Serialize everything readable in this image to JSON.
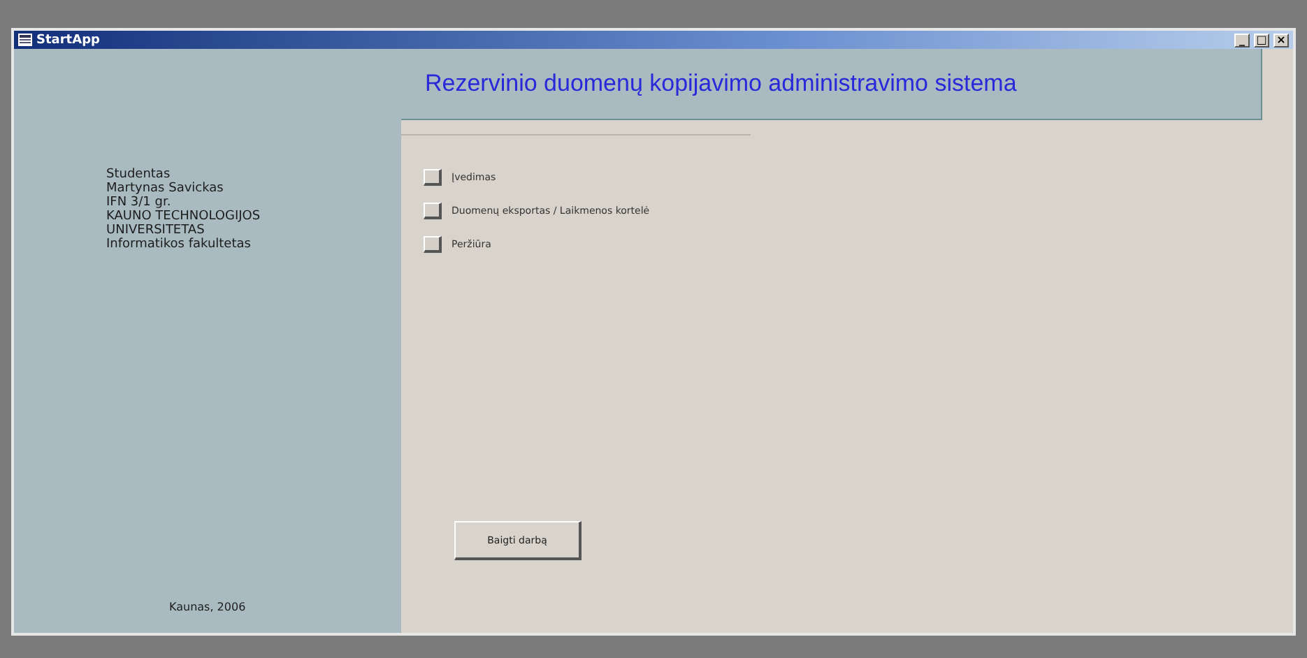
{
  "window": {
    "title": "StartApp",
    "controls": [
      "_",
      "□",
      "×"
    ]
  },
  "sidebar": {
    "lines": [
      "Studentas",
      "Martynas Savickas",
      "IFN 3/1 gr.",
      "KAUNO TECHNOLOGIJOS",
      "UNIVERSITETAS",
      "Informatikos fakultetas"
    ],
    "footer": "Kaunas, 2006"
  },
  "header": {
    "title": "Rezervinio duomenų kopijavimo administravimo sistema"
  },
  "menu": [
    {
      "label": "Įvedimas"
    },
    {
      "label": "Duomenų eksportas / Laikmenos kortelė"
    },
    {
      "label": "Peržiūra"
    }
  ],
  "exit_button": "Baigti darbą"
}
